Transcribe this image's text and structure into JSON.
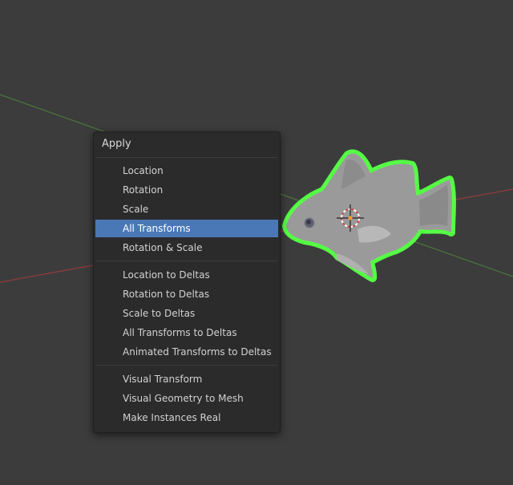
{
  "viewport": {
    "axis_red_color": "#9a3b3b",
    "axis_green_color": "#4a7a3a",
    "outline_color": "#55ff44"
  },
  "menu": {
    "title": "Apply",
    "sections": [
      [
        {
          "id": "location",
          "label": "Location"
        },
        {
          "id": "rotation",
          "label": "Rotation"
        },
        {
          "id": "scale",
          "label": "Scale"
        },
        {
          "id": "all-transforms",
          "label": "All Transforms",
          "active": true
        },
        {
          "id": "rotation-scale",
          "label": "Rotation & Scale"
        }
      ],
      [
        {
          "id": "location-to-deltas",
          "label": "Location to Deltas"
        },
        {
          "id": "rotation-to-deltas",
          "label": "Rotation to Deltas"
        },
        {
          "id": "scale-to-deltas",
          "label": "Scale to Deltas"
        },
        {
          "id": "all-transforms-to-deltas",
          "label": "All Transforms to Deltas"
        },
        {
          "id": "animated-transforms-to-deltas",
          "label": "Animated Transforms to Deltas"
        }
      ],
      [
        {
          "id": "visual-transform",
          "label": "Visual Transform"
        },
        {
          "id": "visual-geometry-to-mesh",
          "label": "Visual Geometry to Mesh"
        },
        {
          "id": "make-instances-real",
          "label": "Make Instances Real"
        }
      ]
    ]
  }
}
